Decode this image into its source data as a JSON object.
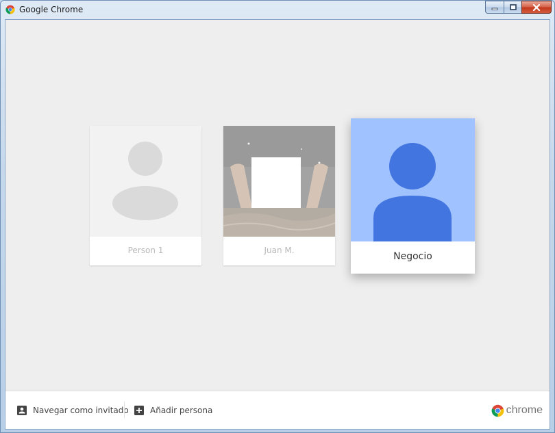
{
  "window": {
    "title": "Google Chrome",
    "app_icon": "chrome-logo-icon"
  },
  "caption_buttons": {
    "minimize_icon": "minimize-icon",
    "maximize_icon": "maximize-icon",
    "close_icon": "close-icon"
  },
  "profiles": [
    {
      "name": "Person 1",
      "avatar": "default-person-avatar",
      "state": "inactive"
    },
    {
      "name": "Juan M.",
      "avatar": "photo-avatar",
      "state": "inactive"
    },
    {
      "name": "Negocio",
      "avatar": "blue-person-avatar",
      "state": "selected"
    }
  ],
  "bottombar": {
    "guest_label": "Navegar como invitado",
    "add_label": "Añadir persona",
    "brand_text": "chrome"
  },
  "colors": {
    "selected_card_bg": "#a0c3ff",
    "selected_avatar": "#4375e0",
    "inactive_avatar": "#dadada",
    "client_bg": "#eeeeee"
  }
}
